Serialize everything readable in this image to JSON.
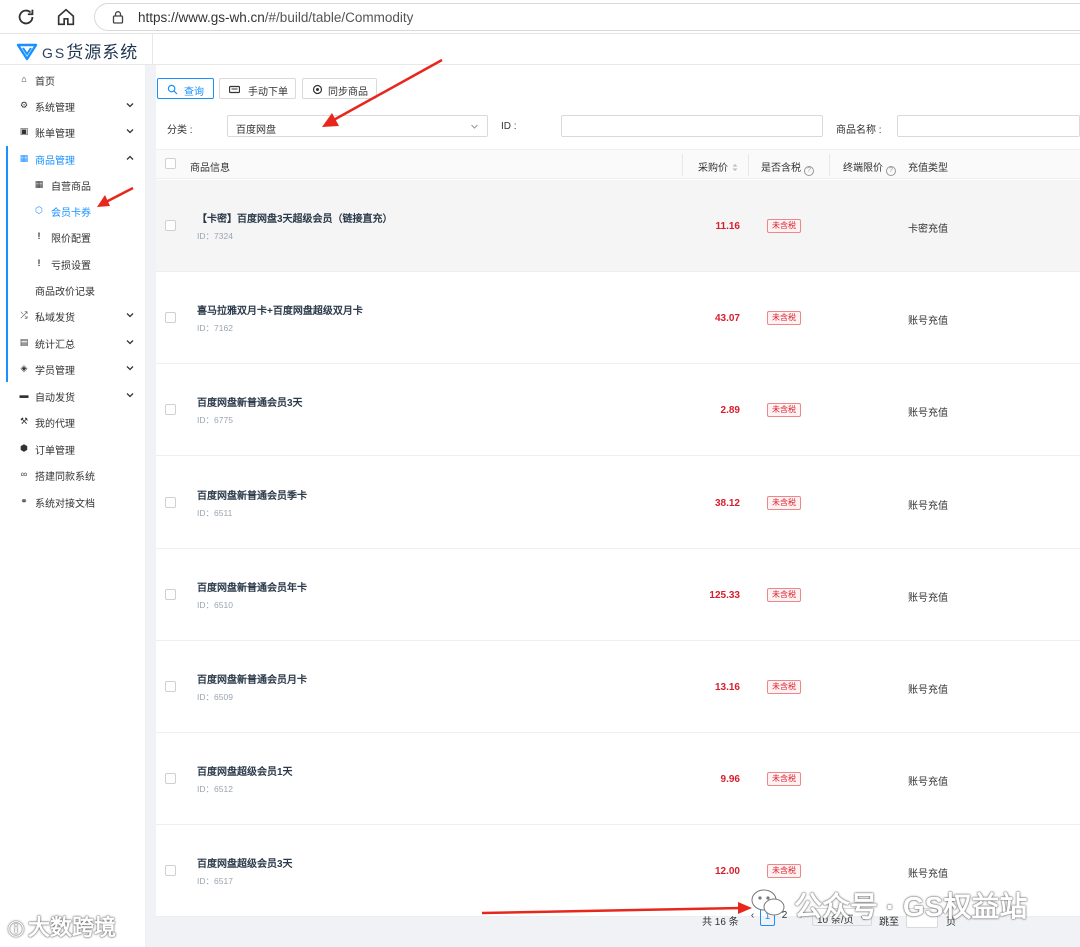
{
  "browser": {
    "url_host": "https://www.gs-wh.cn",
    "url_path": "/#/build/table/Commodity"
  },
  "app": {
    "logo_prefix": "GS",
    "logo_name": "货源系统"
  },
  "sidebar": {
    "items": [
      {
        "label": "首页",
        "icon": "home-icon"
      },
      {
        "label": "系统管理",
        "icon": "cogs-icon",
        "arrow": "down"
      },
      {
        "label": "账单管理",
        "icon": "money-icon",
        "arrow": "down"
      },
      {
        "label": "商品管理",
        "icon": "calendar-icon",
        "arrow": "up",
        "active": true
      },
      {
        "label": "私域发货",
        "icon": "shuffle-icon",
        "arrow": "down"
      },
      {
        "label": "统计汇总",
        "icon": "table-icon",
        "arrow": "down"
      },
      {
        "label": "学员管理",
        "icon": "tag-icon",
        "arrow": "down"
      },
      {
        "label": "自动发货",
        "icon": "car-icon",
        "arrow": "down"
      },
      {
        "label": "我的代理",
        "icon": "gavel-icon"
      },
      {
        "label": "订单管理",
        "icon": "cube-icon"
      },
      {
        "label": "搭建同款系统",
        "icon": "chain-icon"
      },
      {
        "label": "系统对接文档",
        "icon": "link-icon"
      }
    ],
    "sub_items": [
      {
        "label": "自营商品",
        "icon": "calendar-icon"
      },
      {
        "label": "会员卡券",
        "icon": "gem-icon",
        "selected": true
      },
      {
        "label": "限价配置",
        "icon": "exclamation-icon"
      },
      {
        "label": "亏损设置",
        "icon": "exclamation-icon"
      },
      {
        "label": "商品改价记录",
        "icon": ""
      }
    ]
  },
  "toolbar": {
    "query_label": "查询",
    "manual_order_label": "手动下单",
    "sync_label": "同步商品"
  },
  "filters": {
    "category_label": "分类 :",
    "category_value": "百度网盘",
    "id_label": "ID :",
    "name_label": "商品名称 :"
  },
  "table": {
    "headers": {
      "info": "商品信息",
      "price": "采购价",
      "tax": "是否含税",
      "limit": "终端限价",
      "type": "充值类型"
    },
    "id_prefix": "ID：",
    "rows": [
      {
        "name": "【卡密】百度网盘3天超级会员（链接直充）",
        "id": "7324",
        "price": "11.16",
        "tax": "未含税",
        "type": "卡密充值"
      },
      {
        "name": "喜马拉雅双月卡+百度网盘超级双月卡",
        "id": "7162",
        "price": "43.07",
        "tax": "未含税",
        "type": "账号充值"
      },
      {
        "name": "百度网盘新普通会员3天",
        "id": "6775",
        "price": "2.89",
        "tax": "未含税",
        "type": "账号充值"
      },
      {
        "name": "百度网盘新普通会员季卡",
        "id": "6511",
        "price": "38.12",
        "tax": "未含税",
        "type": "账号充值"
      },
      {
        "name": "百度网盘新普通会员年卡",
        "id": "6510",
        "price": "125.33",
        "tax": "未含税",
        "type": "账号充值"
      },
      {
        "name": "百度网盘新普通会员月卡",
        "id": "6509",
        "price": "13.16",
        "tax": "未含税",
        "type": "账号充值"
      },
      {
        "name": "百度网盘超级会员1天",
        "id": "6512",
        "price": "9.96",
        "tax": "未含税",
        "type": "账号充值"
      },
      {
        "name": "百度网盘超级会员3天",
        "id": "6517",
        "price": "12.00",
        "tax": "未含税",
        "type": "账号充值"
      }
    ]
  },
  "pagination": {
    "total": "共 16 条",
    "pages": [
      "1",
      "2"
    ],
    "current_page": "1",
    "page_size": "10 条/页",
    "jump_label": "跳至",
    "page_unit": "页"
  },
  "watermarks": {
    "right": "公众号 · GS权益站",
    "left": "大数跨境"
  },
  "colors": {
    "accent": "#1890ff",
    "price": "#d81e2c",
    "arrow": "#e8271c"
  }
}
